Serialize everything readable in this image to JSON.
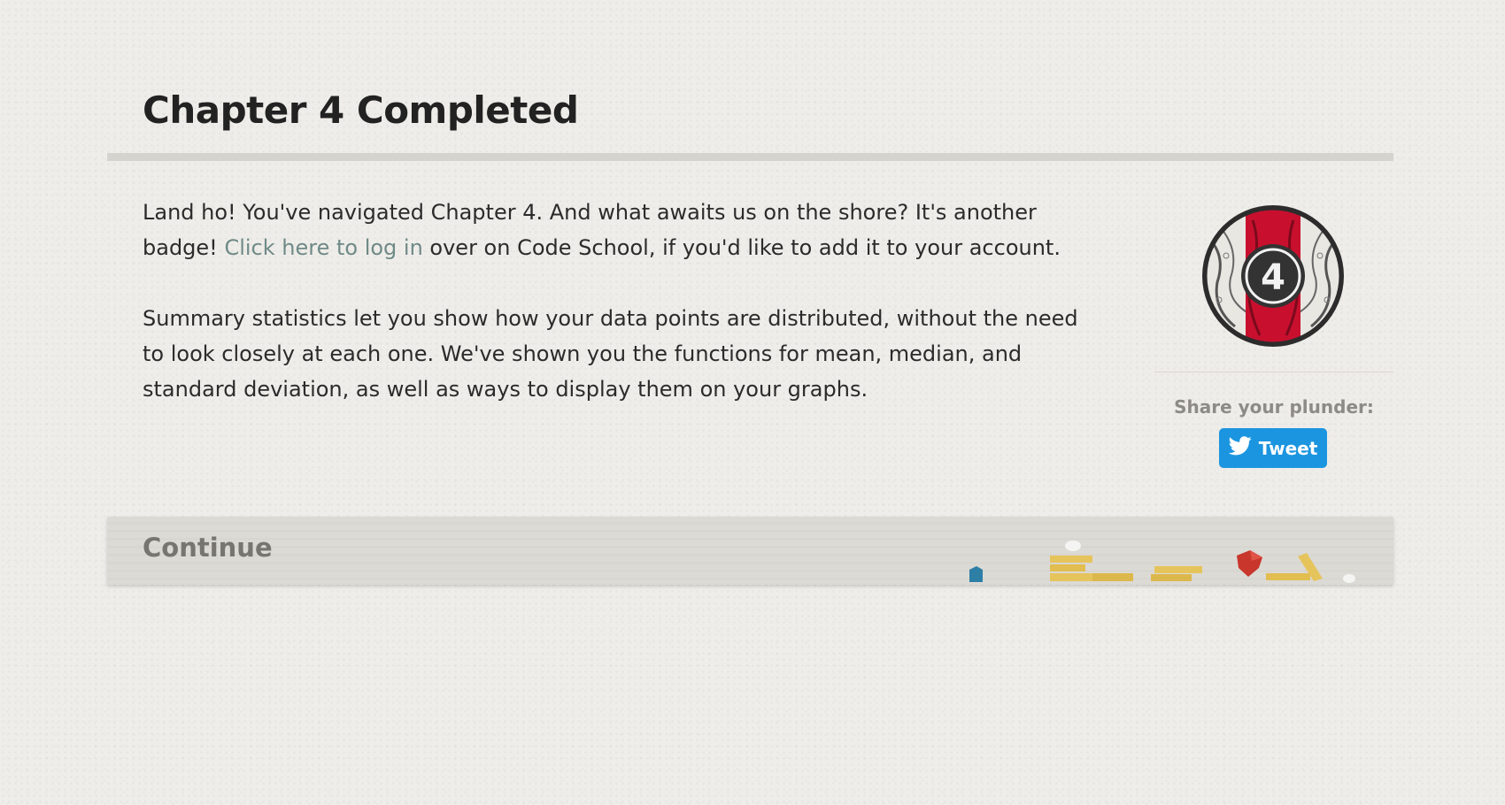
{
  "header": {
    "title": "Chapter 4 Completed"
  },
  "content": {
    "paragraph1_before_link": "Land ho! You've navigated Chapter 4. And what awaits us on the shore? It's another badge! ",
    "login_link_text": "Click here to log in",
    "paragraph1_after_link": " over on Code School, if you'd like to add it to your account.",
    "paragraph2": "Summary statistics let you show how your data points are distributed, without the need to look closely at each one. We've shown you the functions for mean, median, and standard deviation, as well as ways to display them on your graphs."
  },
  "badge": {
    "number": "4",
    "colors": {
      "ring": "#2c2c2c",
      "stripe": "#c8102e",
      "center": "#333333"
    }
  },
  "share": {
    "label": "Share your plunder:",
    "tweet_label": "Tweet",
    "tweet_icon": "twitter-bird-icon"
  },
  "footer": {
    "continue_label": "Continue"
  },
  "colors": {
    "link": "#6f8a87",
    "tweet_button": "#1b95e0",
    "background": "#efede9"
  }
}
